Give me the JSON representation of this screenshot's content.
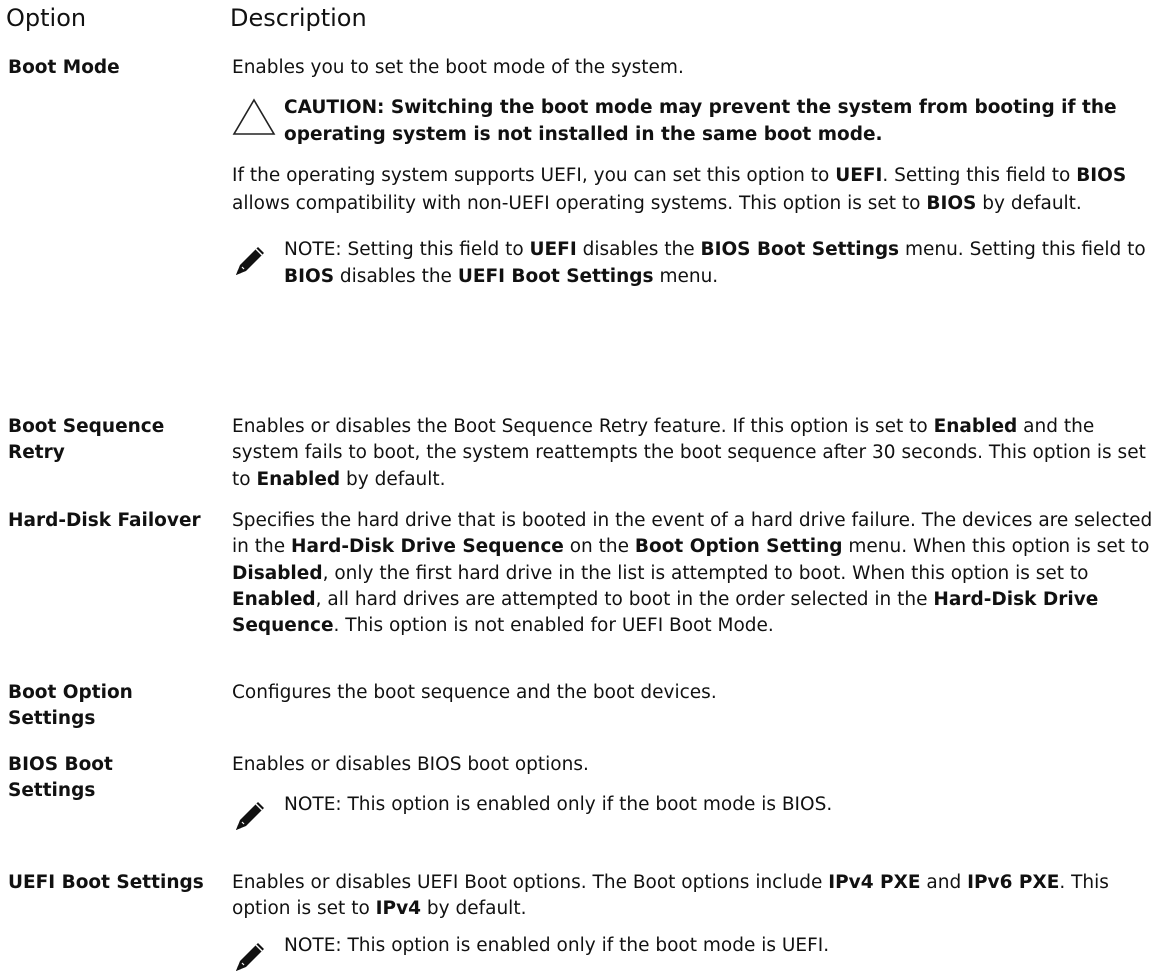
{
  "header": {
    "option": "Option",
    "description": "Description"
  },
  "rows": {
    "boot_mode": {
      "option": "Boot Mode",
      "desc1": "Enables you to set the boot mode of the system.",
      "caution": "CAUTION: Switching the boot mode may prevent the system from booting if the operating system is not installed in the same boot mode.",
      "p2_a": "If the operating system supports UEFI, you can set this option to ",
      "p2_b": "UEFI",
      "p2_c": ". Setting this field to ",
      "p2_d": "BIOS",
      "p2_e": " allows compatibility with non-UEFI operating systems. This option is set to ",
      "p2_f": "BIOS",
      "p2_g": " by default.",
      "note_label": "NOTE:",
      "note_a": " Setting this field to ",
      "note_b": "UEFI",
      "note_c": " disables the ",
      "note_d": "BIOS Boot Settings",
      "note_e": " menu. Setting this field to ",
      "note_f": "BIOS",
      "note_g": " disables the ",
      "note_h": "UEFI Boot Settings",
      "note_i": " menu."
    },
    "boot_seq_retry": {
      "option": "Boot Sequence Retry",
      "a": "Enables or disables the Boot Sequence Retry feature. If this option is set to ",
      "b": "Enabled",
      "c": " and the system fails to boot, the system reattempts the boot sequence after 30 seconds. This option is set to ",
      "d": "Enabled",
      "e": " by default."
    },
    "hdd_failover": {
      "option": "Hard-Disk Failover",
      "a": "Specifies the hard drive that is booted in the event of a hard drive failure. The devices are selected in the ",
      "b": "Hard-Disk Drive Sequence",
      "c": " on the ",
      "d": "Boot Option Setting",
      "e": " menu. When this option is set to ",
      "f": "Disabled",
      "g": ", only the first hard drive in the list is attempted to boot. When this option is set to ",
      "h": "Enabled",
      "i": ", all hard drives are attempted to boot in the order selected in the ",
      "j": "Hard-Disk Drive Sequence",
      "k": ". This option is not enabled for UEFI Boot Mode."
    },
    "boot_option_settings": {
      "option": "Boot Option Settings",
      "desc": "Configures the boot sequence and the boot devices."
    },
    "bios_boot_settings": {
      "option": "BIOS Boot Settings",
      "desc": "Enables or disables BIOS boot options.",
      "note_label": "NOTE:",
      "note": " This option is enabled only if the boot mode is BIOS."
    },
    "uefi_boot_settings": {
      "option": "UEFI Boot Settings",
      "a": "Enables or disables UEFI Boot options. The Boot options include ",
      "b": "IPv4 PXE",
      "c": " and ",
      "d": "IPv6 PXE",
      "e": ". This option is set to ",
      "f": "IPv4",
      "g": " by default.",
      "note_label": "NOTE:",
      "note": " This option is enabled only if the boot mode is UEFI."
    }
  }
}
